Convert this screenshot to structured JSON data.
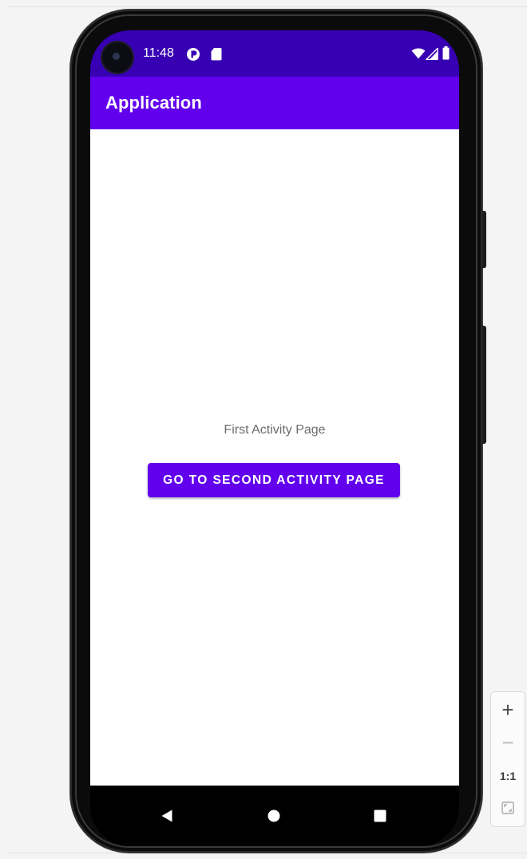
{
  "status_bar": {
    "time": "11:48",
    "icons": [
      "notification-icon",
      "sd-card-icon",
      "wifi-icon",
      "signal-icon",
      "battery-icon"
    ]
  },
  "app_bar": {
    "title": "Application"
  },
  "main": {
    "page_text": "First Activity Page",
    "button_label": "GO TO SECOND ACTIVITY PAGE"
  },
  "nav_bar": {
    "buttons": [
      "back-icon",
      "home-icon",
      "recents-icon"
    ]
  },
  "zoom_controls": {
    "zoom_in": "+",
    "zoom_out": "−",
    "actual_size": "1:1",
    "fit_icon": "fit-screen-icon"
  },
  "colors": {
    "status_bar": "#3700b3",
    "primary": "#6200ee",
    "background": "#ffffff"
  }
}
